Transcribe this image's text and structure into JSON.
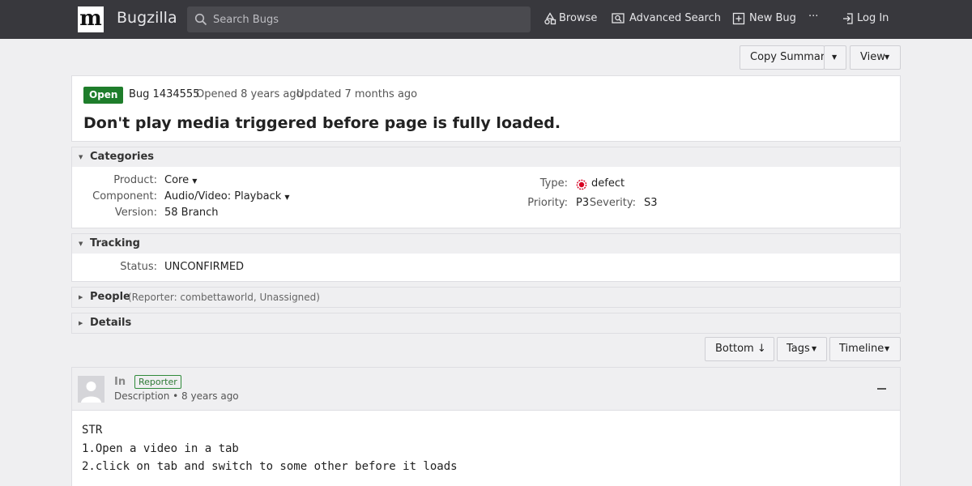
{
  "header": {
    "logo_letter": "m",
    "brand": "Bugzilla",
    "search_placeholder": "Search Bugs",
    "nav": {
      "browse": "Browse",
      "advanced_search": "Advanced Search",
      "new_bug": "New Bug",
      "more": "···",
      "login": "Log In"
    }
  },
  "toolbar": {
    "copy_summary": "Copy Summary",
    "view": "View"
  },
  "bug": {
    "status_badge": "Open",
    "id_text": "Bug 1434555",
    "opened": "Opened 8 years ago",
    "updated": "Updated 7 months ago",
    "title": "Don't play media triggered before page is fully loaded."
  },
  "categories": {
    "heading": "Categories",
    "product_label": "Product:",
    "product_value": "Core",
    "component_label": "Component:",
    "component_value": "Audio/Video: Playback",
    "version_label": "Version:",
    "version_value": "58 Branch",
    "type_label": "Type:",
    "type_value": "defect",
    "priority_label": "Priority:",
    "priority_value": "P3",
    "severity_label": "Severity:",
    "severity_value": "S3"
  },
  "tracking": {
    "heading": "Tracking",
    "status_label": "Status:",
    "status_value": "UNCONFIRMED"
  },
  "people": {
    "heading": "People",
    "summary": "(Reporter: combettaworld, Unassigned)"
  },
  "details": {
    "heading": "Details"
  },
  "comment_toolbar": {
    "bottom": "Bottom ↓",
    "tags": "Tags",
    "timeline": "Timeline"
  },
  "comment": {
    "author": "In",
    "role": "Reporter",
    "meta": "Description • 8 years ago",
    "text": "STR\n1.Open a video in a tab\n2.click on tab and switch to some other before it loads"
  },
  "colors": {
    "topbar": "#38383d",
    "open_badge": "#1e7d2b",
    "defect_icon": "#d70022",
    "reporter_badge": "#2f8a3a"
  },
  "icons": {
    "search": "search-icon",
    "browse": "browse-icon",
    "advanced_search": "advanced-search-icon",
    "new_bug": "plus-box-icon",
    "login": "login-icon",
    "defect": "bug-icon",
    "avatar": "user-icon",
    "collapse": "minus-icon"
  }
}
